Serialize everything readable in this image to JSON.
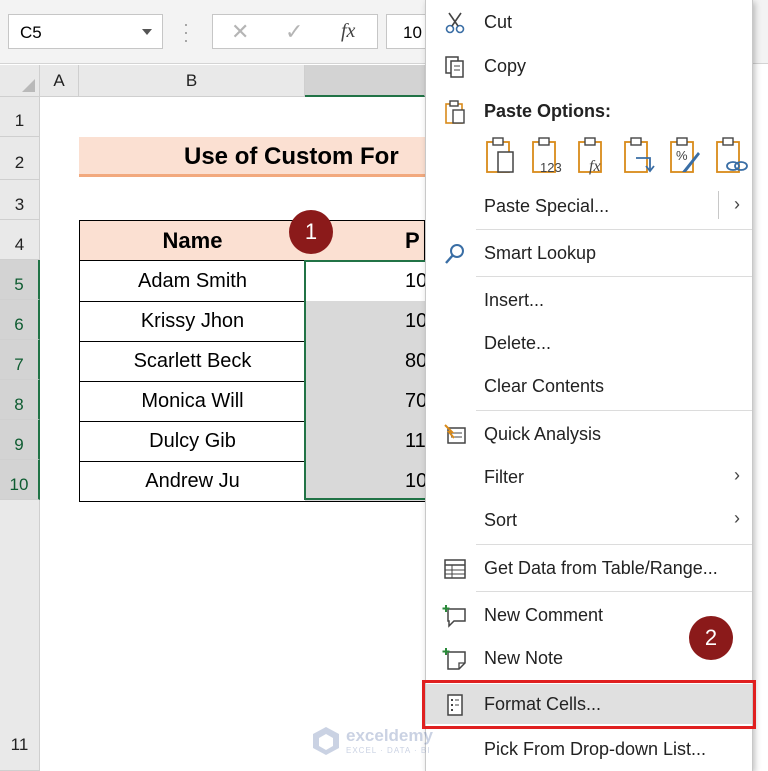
{
  "formula_bar": {
    "name_box": "C5",
    "formula_value": "10"
  },
  "columns": [
    "A",
    "B"
  ],
  "rows": [
    "1",
    "2",
    "3",
    "4",
    "5",
    "6",
    "7",
    "8",
    "9",
    "10",
    "11"
  ],
  "sheet": {
    "title": "Use of Custom For",
    "header_name": "Name",
    "header_col_c": "P",
    "rows": [
      {
        "name": "Adam Smith",
        "value": "10"
      },
      {
        "name": "Krissy Jhon",
        "value": "10"
      },
      {
        "name": "Scarlett Beck",
        "value": "80"
      },
      {
        "name": "Monica Will",
        "value": "70"
      },
      {
        "name": "Dulcy Gib",
        "value": "11"
      },
      {
        "name": "Andrew Ju",
        "value": "10"
      }
    ]
  },
  "badges": {
    "one": "1",
    "two": "2"
  },
  "context_menu": {
    "cut": "Cut",
    "copy": "Copy",
    "paste_options": "Paste Options:",
    "paste_special": "Paste Special...",
    "smart_lookup": "Smart Lookup",
    "insert": "Insert...",
    "delete": "Delete...",
    "clear_contents": "Clear Contents",
    "quick_analysis": "Quick Analysis",
    "filter": "Filter",
    "sort": "Sort",
    "get_data": "Get Data from Table/Range...",
    "new_comment": "New Comment",
    "new_note": "New Note",
    "format_cells": "Format Cells...",
    "pick_from_list": "Pick From Drop-down List...",
    "submenu_arrow": "›"
  },
  "watermark": {
    "name": "exceldemy",
    "sub": "EXCEL · DATA · BI"
  },
  "colors": {
    "accent_green": "#217346",
    "header_fill": "#fbe0d2",
    "highlight_red": "#e02020",
    "badge": "#8b1a1a"
  }
}
